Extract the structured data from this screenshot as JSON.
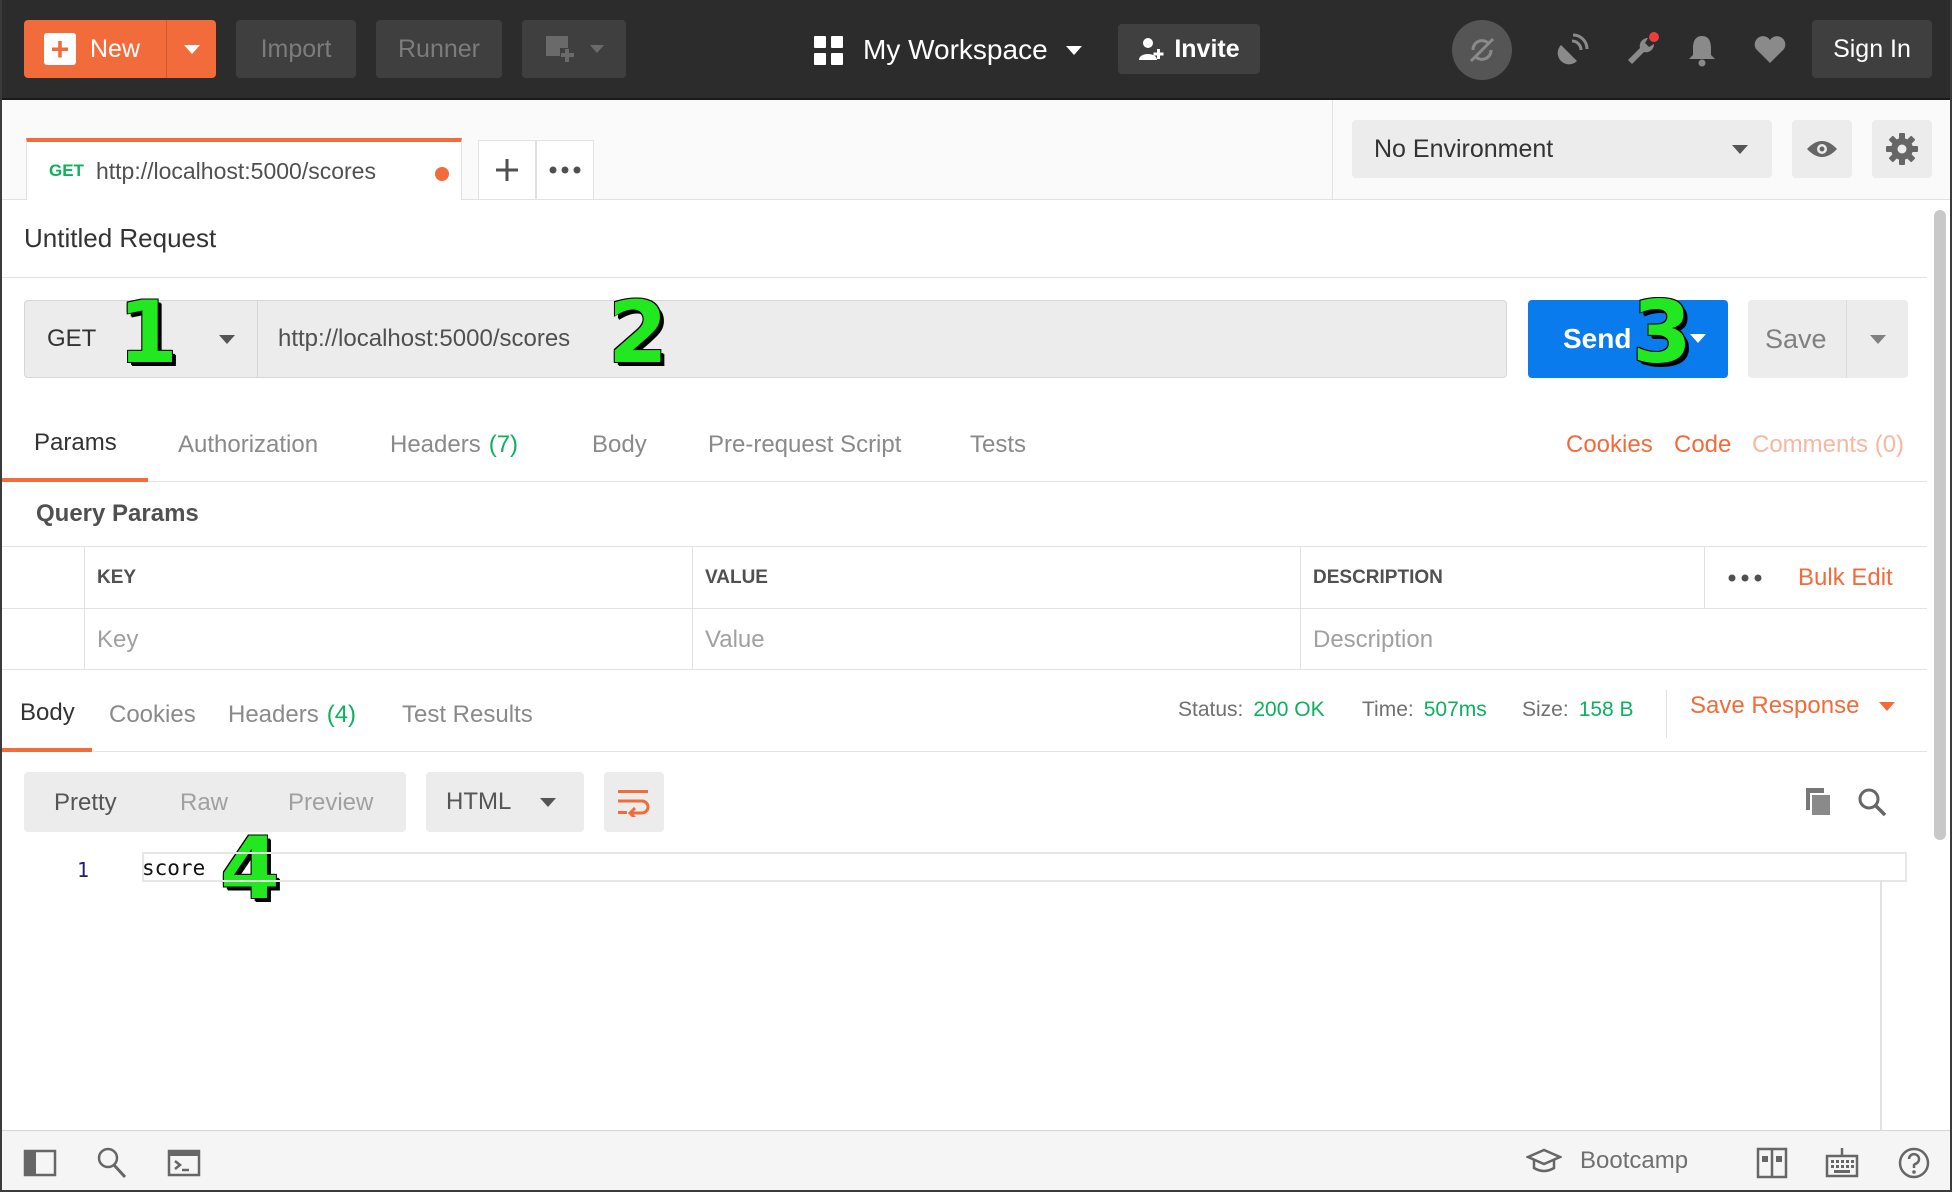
{
  "topbar": {
    "new_label": "New",
    "import_label": "Import",
    "runner_label": "Runner",
    "workspace_label": "My Workspace",
    "invite_label": "Invite",
    "signin_label": "Sign In"
  },
  "tabs": {
    "active": {
      "method": "GET",
      "url": "http://localhost:5000/scores",
      "unsaved": true
    }
  },
  "environment": {
    "selected": "No Environment"
  },
  "request": {
    "title": "Untitled Request",
    "method": "GET",
    "url": "http://localhost:5000/scores",
    "send_label": "Send",
    "save_label": "Save"
  },
  "request_tabs": {
    "params": "Params",
    "authorization": "Authorization",
    "headers": "Headers",
    "headers_count": "(7)",
    "body": "Body",
    "prerequest": "Pre-request Script",
    "tests": "Tests",
    "cookies": "Cookies",
    "code": "Code",
    "comments": "Comments (0)"
  },
  "query_params": {
    "title": "Query Params",
    "col_key": "KEY",
    "col_value": "VALUE",
    "col_description": "DESCRIPTION",
    "bulk_edit": "Bulk Edit",
    "ph_key": "Key",
    "ph_value": "Value",
    "ph_description": "Description"
  },
  "response_tabs": {
    "body": "Body",
    "cookies": "Cookies",
    "headers": "Headers",
    "headers_count": "(4)",
    "test_results": "Test Results"
  },
  "response_status": {
    "status_label": "Status:",
    "status_value": "200 OK",
    "time_label": "Time:",
    "time_value": "507ms",
    "size_label": "Size:",
    "size_value": "158 B",
    "save_response": "Save Response"
  },
  "response_view": {
    "pretty": "Pretty",
    "raw": "Raw",
    "preview": "Preview",
    "format": "HTML"
  },
  "response_body": {
    "lines": [
      {
        "no": "1",
        "text": "score"
      }
    ]
  },
  "annotations": [
    "1",
    "2",
    "3",
    "4"
  ],
  "statusbar": {
    "bootcamp": "Bootcamp"
  },
  "colors": {
    "accent": "#f26b3a",
    "send": "#097bed",
    "success": "#0cb05f",
    "badge": "#22e81f"
  }
}
